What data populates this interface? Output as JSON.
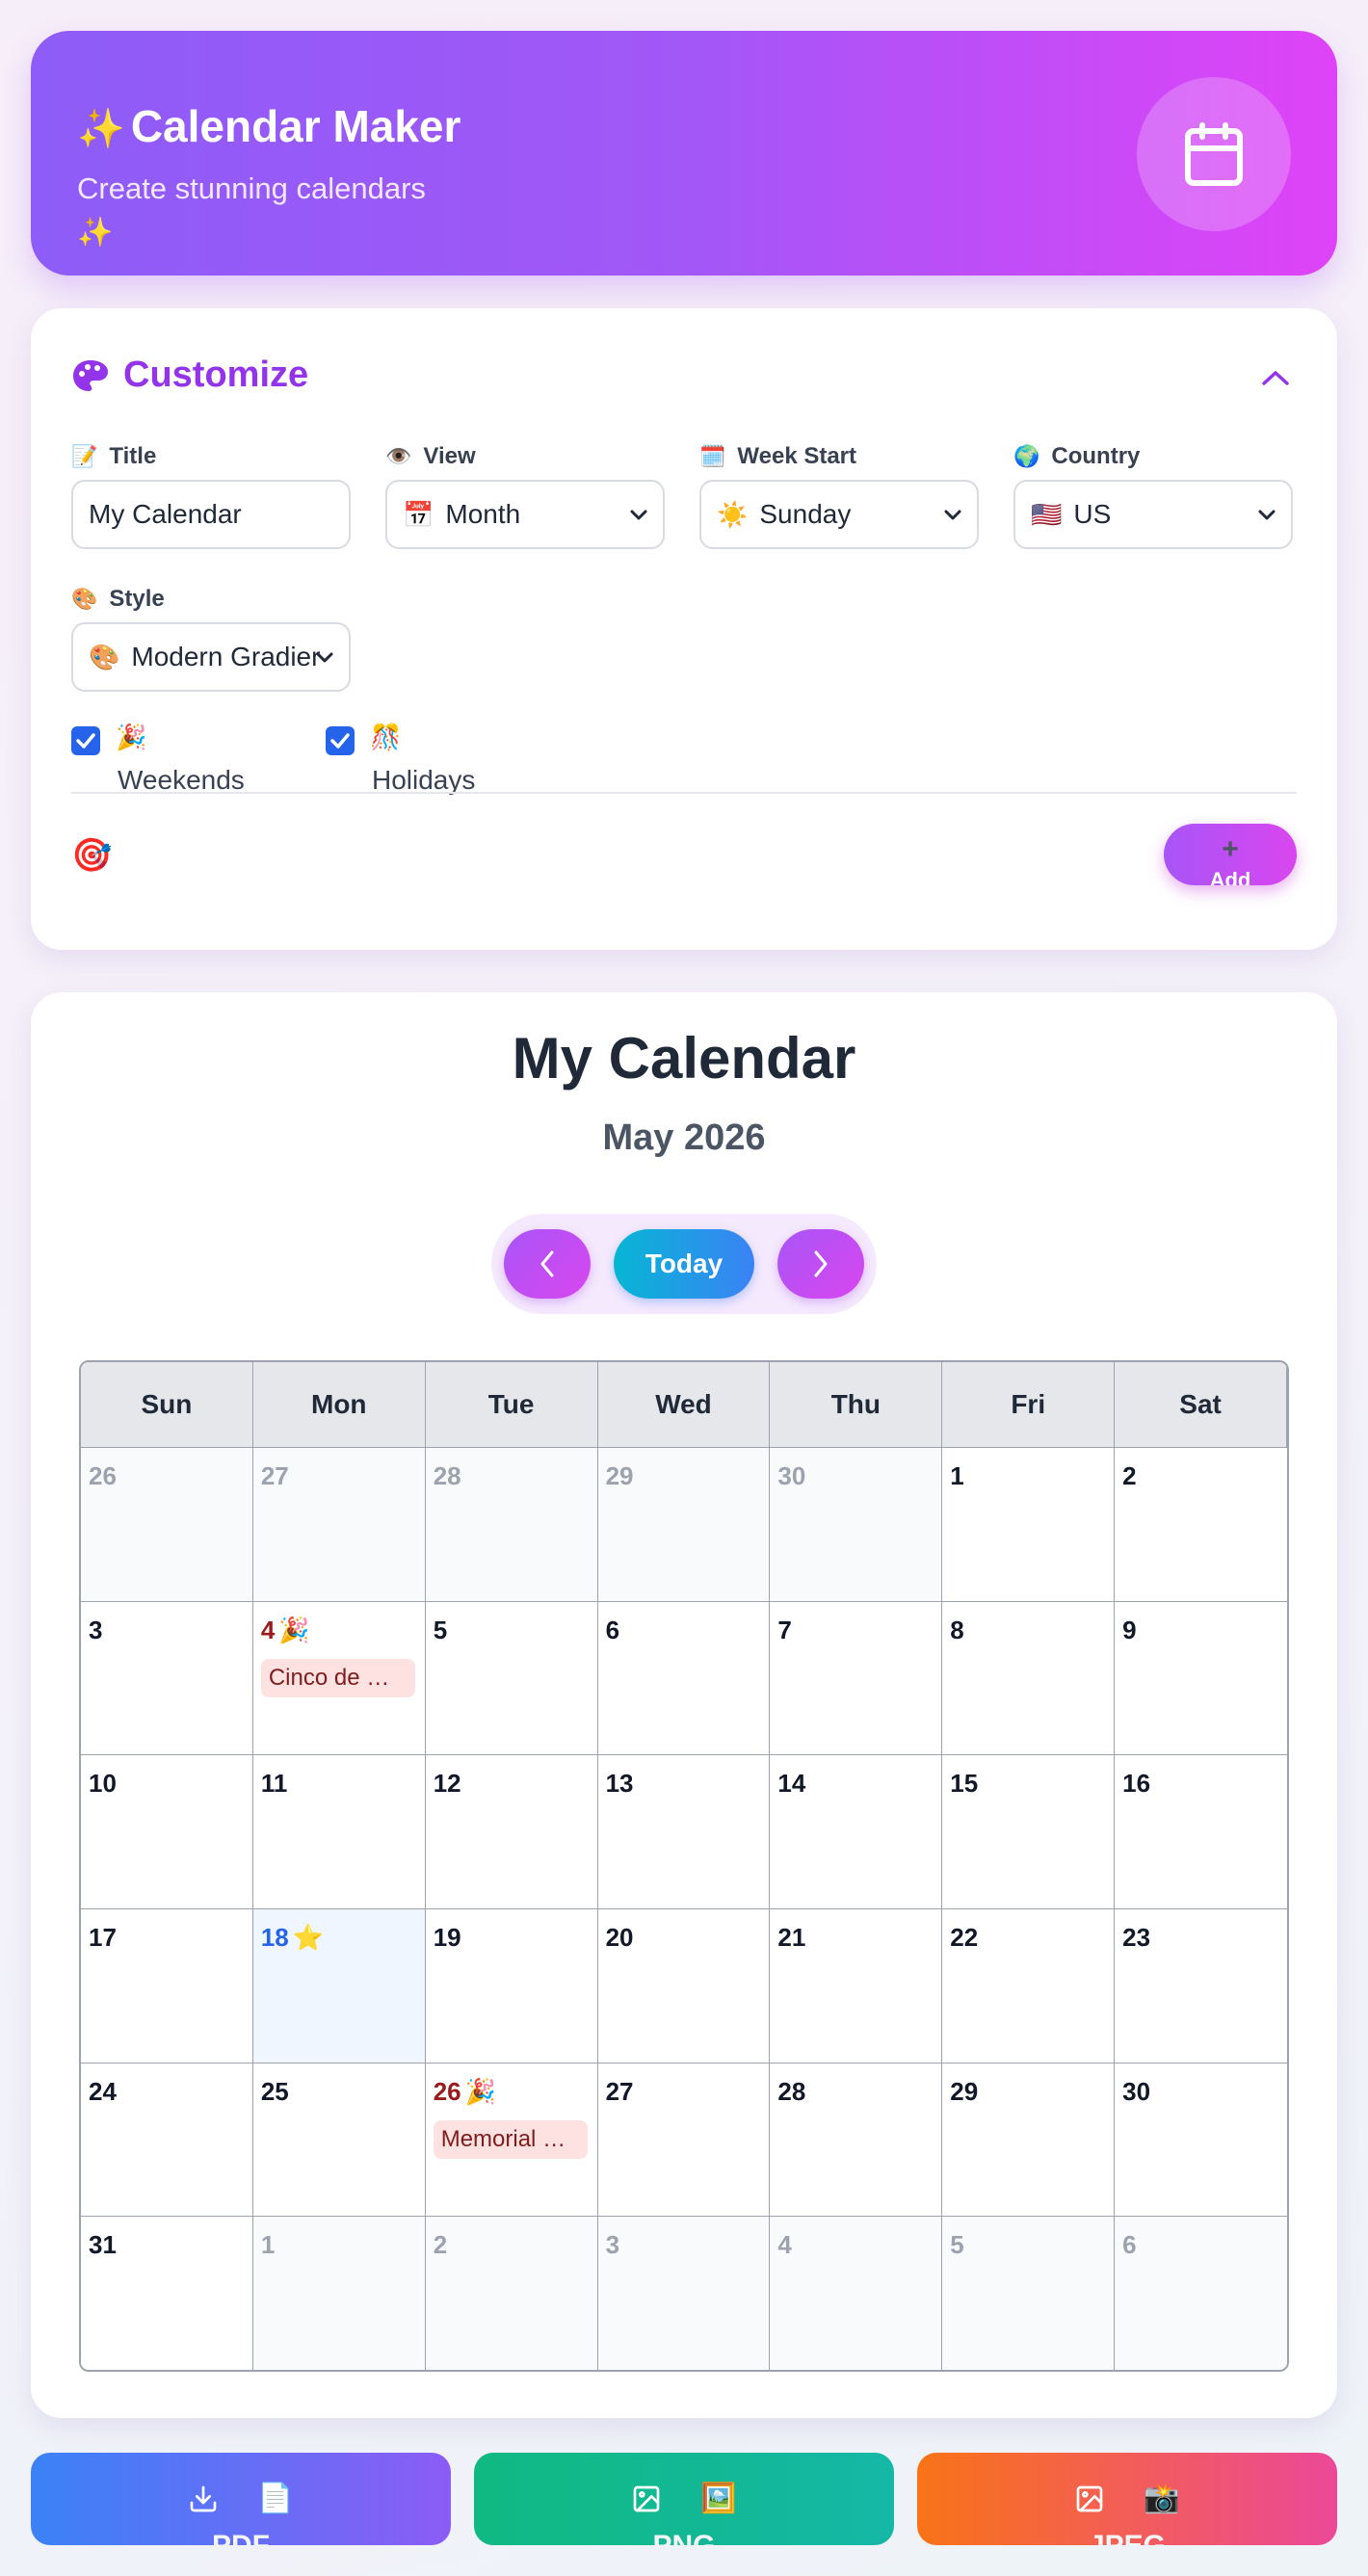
{
  "header": {
    "sparkle": "✨",
    "title": "Calendar Maker",
    "subtitle": "Create stunning calendars",
    "sparkle_trailing": "✨",
    "badge_icon": "calendar-icon"
  },
  "customize": {
    "title": "Customize",
    "title_icon": "palette-icon",
    "fields": {
      "title": {
        "emoji": "📝",
        "label": "Title",
        "value": "My Calendar"
      },
      "view": {
        "emoji": "👁️",
        "label": "View",
        "option_emoji": "📅",
        "selected": "Month"
      },
      "week_start": {
        "emoji": "🗓️",
        "label": "Week Start",
        "option_emoji": "☀️",
        "selected": "Sunday"
      },
      "country": {
        "emoji": "🌍",
        "label": "Country",
        "option_emoji": "🇺🇸",
        "selected": "US"
      },
      "style": {
        "emoji": "🎨",
        "label": "Style",
        "option_emoji": "🎨",
        "selected": "Modern Gradient"
      }
    },
    "toggles": {
      "weekends": {
        "emoji": "🎉",
        "label": "Weekends",
        "checked": true
      },
      "holidays": {
        "emoji": "🎊",
        "label": "Holidays",
        "checked": true
      }
    },
    "event_icon": "🎯",
    "add_button": {
      "plus": "+",
      "label": "Add"
    }
  },
  "calendar": {
    "title": "My Calendar",
    "month": "May 2026",
    "today_label": "Today",
    "weekdays": [
      "Sun",
      "Mon",
      "Tue",
      "Wed",
      "Thu",
      "Fri",
      "Sat"
    ],
    "weeks": [
      [
        {
          "day": "26",
          "other": true
        },
        {
          "day": "27",
          "other": true
        },
        {
          "day": "28",
          "other": true
        },
        {
          "day": "29",
          "other": true
        },
        {
          "day": "30",
          "other": true
        },
        {
          "day": "1"
        },
        {
          "day": "2"
        }
      ],
      [
        {
          "day": "3"
        },
        {
          "day": "4",
          "holiday": true,
          "emoji": "🎉",
          "event": "Cinco de Mayo"
        },
        {
          "day": "5"
        },
        {
          "day": "6"
        },
        {
          "day": "7"
        },
        {
          "day": "8"
        },
        {
          "day": "9"
        }
      ],
      [
        {
          "day": "10"
        },
        {
          "day": "11"
        },
        {
          "day": "12"
        },
        {
          "day": "13"
        },
        {
          "day": "14"
        },
        {
          "day": "15"
        },
        {
          "day": "16"
        }
      ],
      [
        {
          "day": "17"
        },
        {
          "day": "18",
          "today": true,
          "emoji": "⭐"
        },
        {
          "day": "19"
        },
        {
          "day": "20"
        },
        {
          "day": "21"
        },
        {
          "day": "22"
        },
        {
          "day": "23"
        }
      ],
      [
        {
          "day": "24"
        },
        {
          "day": "25"
        },
        {
          "day": "26",
          "holiday": true,
          "emoji": "🎉",
          "event": "Memorial Day"
        },
        {
          "day": "27"
        },
        {
          "day": "28"
        },
        {
          "day": "29"
        },
        {
          "day": "30"
        }
      ],
      [
        {
          "day": "31"
        },
        {
          "day": "1",
          "other": true
        },
        {
          "day": "2",
          "other": true
        },
        {
          "day": "3",
          "other": true
        },
        {
          "day": "4",
          "other": true
        },
        {
          "day": "5",
          "other": true
        },
        {
          "day": "6",
          "other": true
        }
      ]
    ]
  },
  "export": [
    {
      "label": "PDF",
      "icon": "download-icon",
      "emoji": "📄",
      "gradient": [
        "#3b82f6",
        "#8b5cf6"
      ]
    },
    {
      "label": "PNG",
      "icon": "image-icon",
      "emoji": "🖼️",
      "gradient": [
        "#10b981",
        "#14b8a6"
      ]
    },
    {
      "label": "JPEG",
      "icon": "image-icon",
      "emoji": "📸",
      "gradient": [
        "#f97316",
        "#ec4899"
      ]
    }
  ],
  "colors": {
    "accent": "#9333ea",
    "holiday_text": "#991b1b",
    "holiday_bg": "#fee2e2",
    "today_text": "#2563eb"
  }
}
